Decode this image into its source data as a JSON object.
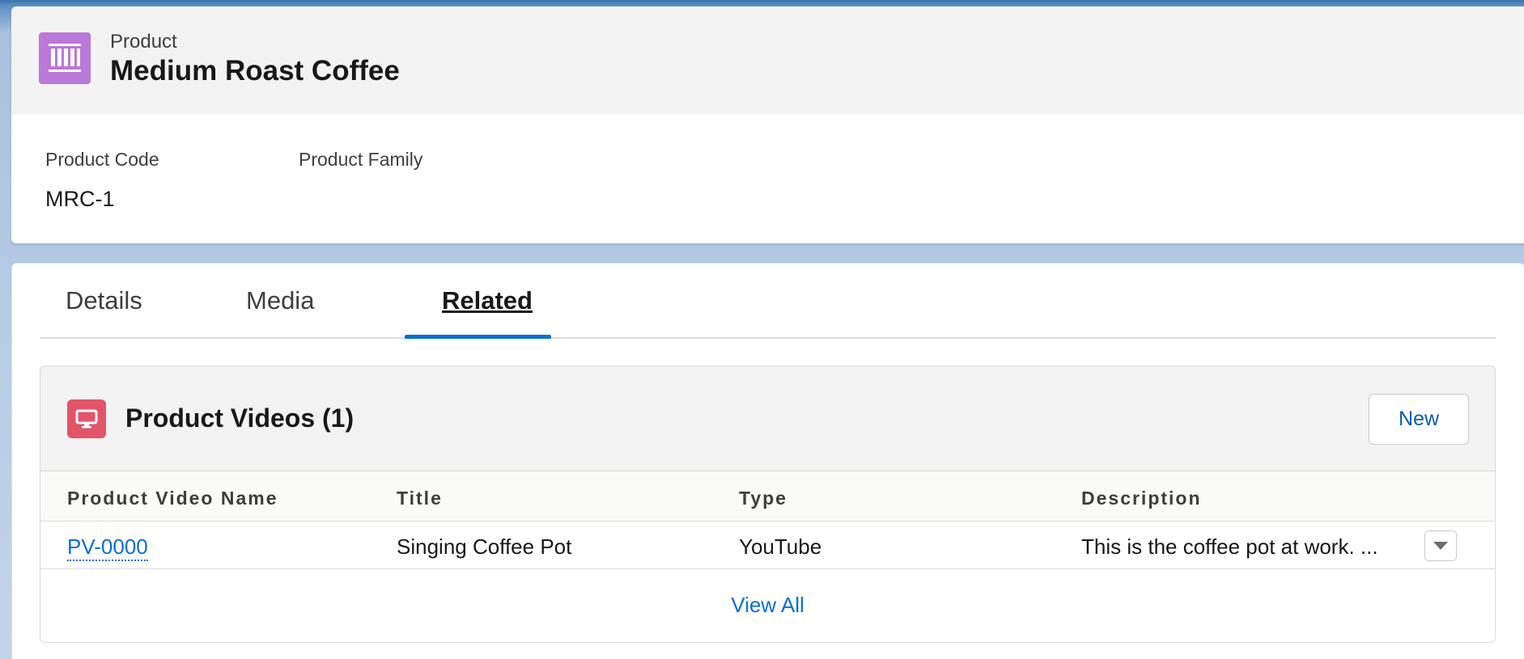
{
  "header": {
    "object_label": "Product",
    "record_title": "Medium Roast Coffee",
    "icon": "product-icon",
    "fields": [
      {
        "label": "Product Code",
        "value": "MRC-1"
      },
      {
        "label": "Product Family",
        "value": ""
      }
    ]
  },
  "tabs": [
    {
      "label": "Details",
      "active": false
    },
    {
      "label": "Media",
      "active": false
    },
    {
      "label": "Related",
      "active": true
    }
  ],
  "related_list": {
    "icon": "desktop-video-icon",
    "title": "Product Videos (1)",
    "new_button_label": "New",
    "columns": [
      "Product Video Name",
      "Title",
      "Type",
      "Description"
    ],
    "rows": [
      {
        "name": "PV-0000",
        "title": "Singing Coffee Pot",
        "type": "YouTube",
        "description": "This is the coffee pot at work. ..."
      }
    ],
    "row_menu_icon": "chevron-down-icon",
    "view_all_label": "View All"
  },
  "colors": {
    "product_icon_bg": "#ba78d8",
    "video_icon_bg": "#e2546a",
    "link": "#0b6ed4",
    "active_tab_indicator": "#0b6ed4"
  }
}
